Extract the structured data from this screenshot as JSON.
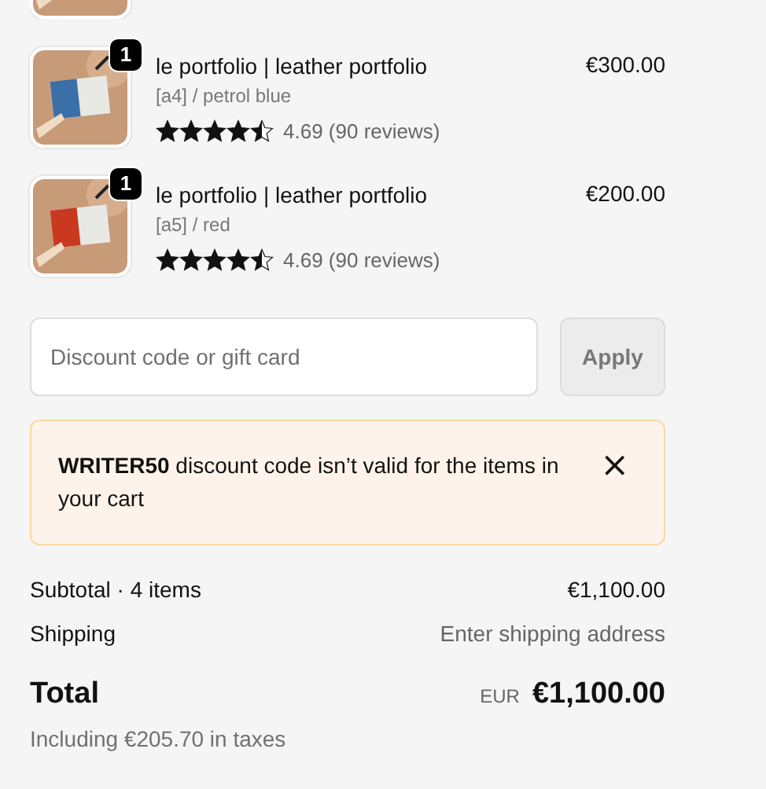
{
  "items": [
    {
      "kind": "partial"
    },
    {
      "kind": "full",
      "quantity": "1",
      "title": "le portfolio | leather portfolio",
      "variant": "[a4] / petrol blue",
      "stars": 4.5,
      "rating": "4.69 (90 reviews)",
      "price": "€300.00",
      "color": "#3a6fa8"
    },
    {
      "kind": "full",
      "quantity": "1",
      "title": "le portfolio | leather portfolio",
      "variant": "[a5] / red",
      "stars": 4.5,
      "rating": "4.69 (90 reviews)",
      "price": "€200.00",
      "color": "#c8391f"
    }
  ],
  "discount": {
    "placeholder": "Discount code or gift card",
    "button": "Apply",
    "disabled": true
  },
  "notice": {
    "text": "**WRITER50** discount code isn’t valid for the items in your cart",
    "close": "×"
  },
  "summary": [
    {
      "label": "Subtotal · 4 items",
      "value": "€1,100.00",
      "muted": false
    },
    {
      "label": "Shipping",
      "value": "Enter shipping address",
      "muted": true
    }
  ],
  "total": {
    "label": "Total",
    "currency": "EUR",
    "value": "€1,100.00",
    "taxes": "Including €205.70 in taxes"
  }
}
